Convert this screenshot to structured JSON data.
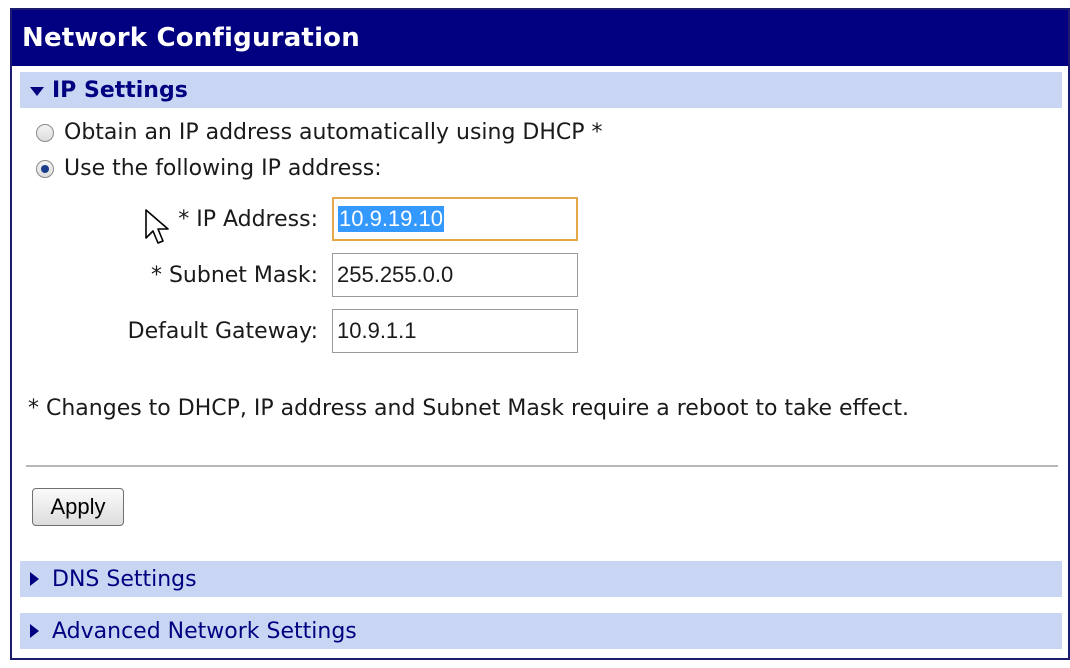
{
  "panel": {
    "title": "Network Configuration"
  },
  "ip_settings": {
    "header": "IP Settings",
    "radio_dhcp": {
      "label": "Obtain an IP address automatically using DHCP *",
      "checked": false
    },
    "radio_static": {
      "label": "Use the following IP address:",
      "checked": true
    },
    "fields": {
      "ip_address": {
        "label": "* IP Address:",
        "value": "10.9.19.10"
      },
      "subnet_mask": {
        "label": "* Subnet Mask:",
        "value": "255.255.0.0"
      },
      "default_gateway": {
        "label": "Default Gateway:",
        "value": "10.9.1.1"
      }
    },
    "note": "* Changes to DHCP, IP address and Subnet Mask require a reboot to take effect."
  },
  "apply_label": "Apply",
  "dns_settings": {
    "header": "DNS Settings"
  },
  "advanced_settings": {
    "header": "Advanced Network Settings"
  },
  "icons": {
    "expanded": "triangle-down-icon",
    "collapsed": "triangle-right-icon",
    "cursor": "mouse-pointer-icon"
  },
  "colors": {
    "title_bar": "#000080",
    "section_header_bg": "#c8d6f4",
    "section_header_text": "#000080",
    "selection": "#3399ff",
    "focus_border": "#e4a84a"
  }
}
